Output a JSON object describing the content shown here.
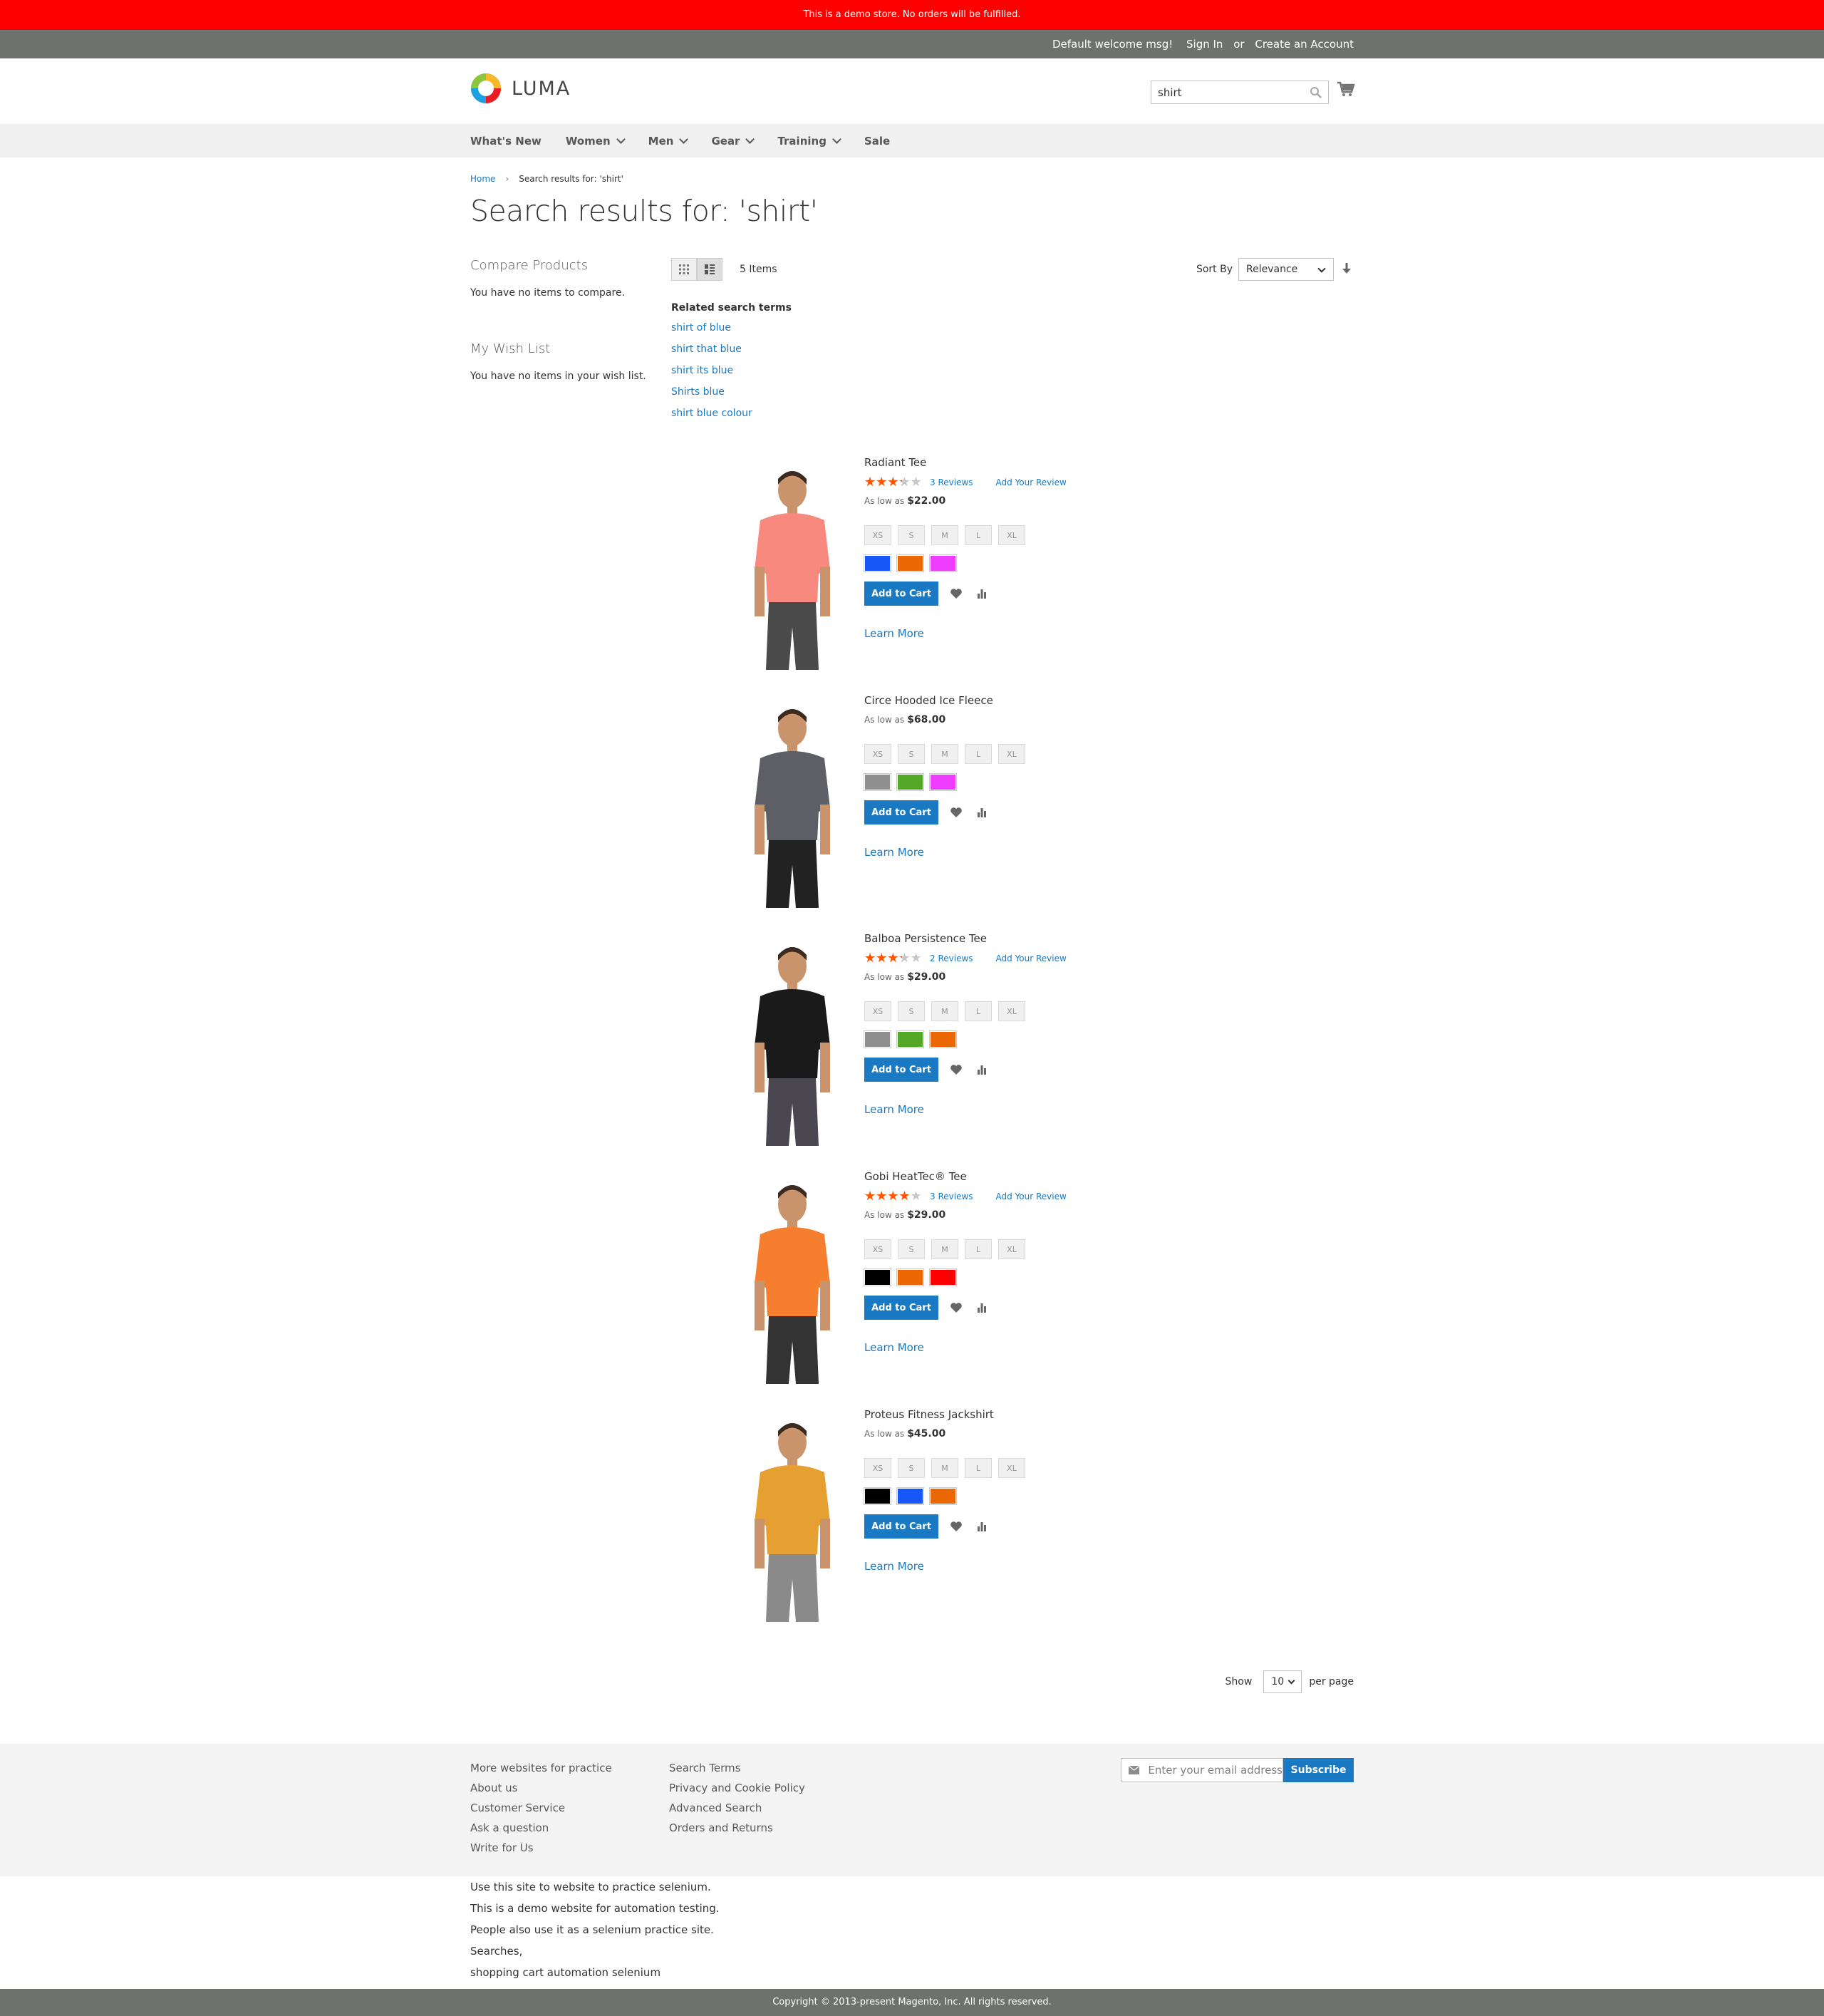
{
  "demo_notice": "This is a demo store. No orders will be fulfilled.",
  "header": {
    "welcome": "Default welcome msg!",
    "sign_in": "Sign In",
    "or": "or",
    "create_account": "Create an Account"
  },
  "logo": {
    "text": "LUMA"
  },
  "search": {
    "value": "shirt"
  },
  "nav": [
    {
      "label": "What's New",
      "has_submenu": false
    },
    {
      "label": "Women",
      "has_submenu": true
    },
    {
      "label": "Men",
      "has_submenu": true
    },
    {
      "label": "Gear",
      "has_submenu": true
    },
    {
      "label": "Training",
      "has_submenu": true
    },
    {
      "label": "Sale",
      "has_submenu": false
    }
  ],
  "breadcrumb": {
    "home": "Home",
    "current": "Search results for: 'shirt'"
  },
  "page_title": "Search results for: 'shirt'",
  "sidebar": {
    "compare_title": "Compare Products",
    "compare_text": "You have no items to compare.",
    "wishlist_title": "My Wish List",
    "wishlist_text": "You have no items in your wish list."
  },
  "toolbar": {
    "items_count": "5 Items",
    "sort_label": "Sort By",
    "sort_value": "Relevance"
  },
  "related": {
    "title": "Related search terms",
    "terms": [
      "shirt of blue",
      "shirt that blue",
      "shirt its blue",
      "Shirts blue",
      "shirt blue colour"
    ]
  },
  "product_labels": {
    "as_low_as": "As low as",
    "add_to_cart": "Add to Cart",
    "learn_more": "Learn More",
    "add_review": "Add Your Review",
    "sizes": [
      "XS",
      "S",
      "M",
      "L",
      "XL"
    ]
  },
  "products": [
    {
      "name": "Radiant Tee",
      "rating_percent": 60,
      "reviews": "3  Reviews",
      "price": "$22.00",
      "swatches": [
        "#1857f7",
        "#eb6703",
        "#ef3dff"
      ],
      "shirt_color": "#f8897f",
      "pants_color": "#4a4a4a"
    },
    {
      "name": "Circe Hooded Ice Fleece",
      "rating_percent": null,
      "reviews": "",
      "price": "$68.00",
      "swatches": [
        "#8f8f8f",
        "#53a828",
        "#ef3dff"
      ],
      "shirt_color": "#5e5e66",
      "pants_color": "#222222"
    },
    {
      "name": "Balboa Persistence Tee",
      "rating_percent": 60,
      "reviews": "2  Reviews",
      "price": "$29.00",
      "swatches": [
        "#8f8f8f",
        "#53a828",
        "#eb6703"
      ],
      "shirt_color": "#1a1a1a",
      "pants_color": "#4a4750"
    },
    {
      "name": "Gobi HeatTec® Tee",
      "rating_percent": 70,
      "reviews": "3  Reviews",
      "price": "$29.00",
      "swatches": [
        "#000000",
        "#eb6703",
        "#ff0000"
      ],
      "shirt_color": "#f57f2e",
      "pants_color": "#333333"
    },
    {
      "name": "Proteus Fitness Jackshirt",
      "rating_percent": null,
      "reviews": "",
      "price": "$45.00",
      "swatches": [
        "#000000",
        "#1857f7",
        "#eb6703"
      ],
      "shirt_color": "#e6a032",
      "pants_color": "#8a8a8a"
    }
  ],
  "limiter": {
    "show": "Show",
    "value": "10",
    "per_page": "per page"
  },
  "footer": {
    "col1": [
      "More websites for practice",
      "About us",
      "Customer Service",
      "Ask a question",
      "Write for Us"
    ],
    "col2": [
      "Search Terms",
      "Privacy and Cookie Policy",
      "Advanced Search",
      "Orders and Returns"
    ],
    "newsletter_placeholder": "Enter your email address",
    "subscribe": "Subscribe",
    "notes": [
      "Use this site to website to practice selenium.",
      "This is a demo website for automation testing.",
      "People also use it as a selenium practice site.",
      "Searches,",
      "shopping cart automation selenium"
    ],
    "copyright": "Copyright © 2013-present Magento, Inc. All rights reserved."
  },
  "colors": {
    "demo_bar": "#ff0000",
    "panel": "#6e716e",
    "accent": "#1979c3",
    "star": "#ff5501"
  }
}
